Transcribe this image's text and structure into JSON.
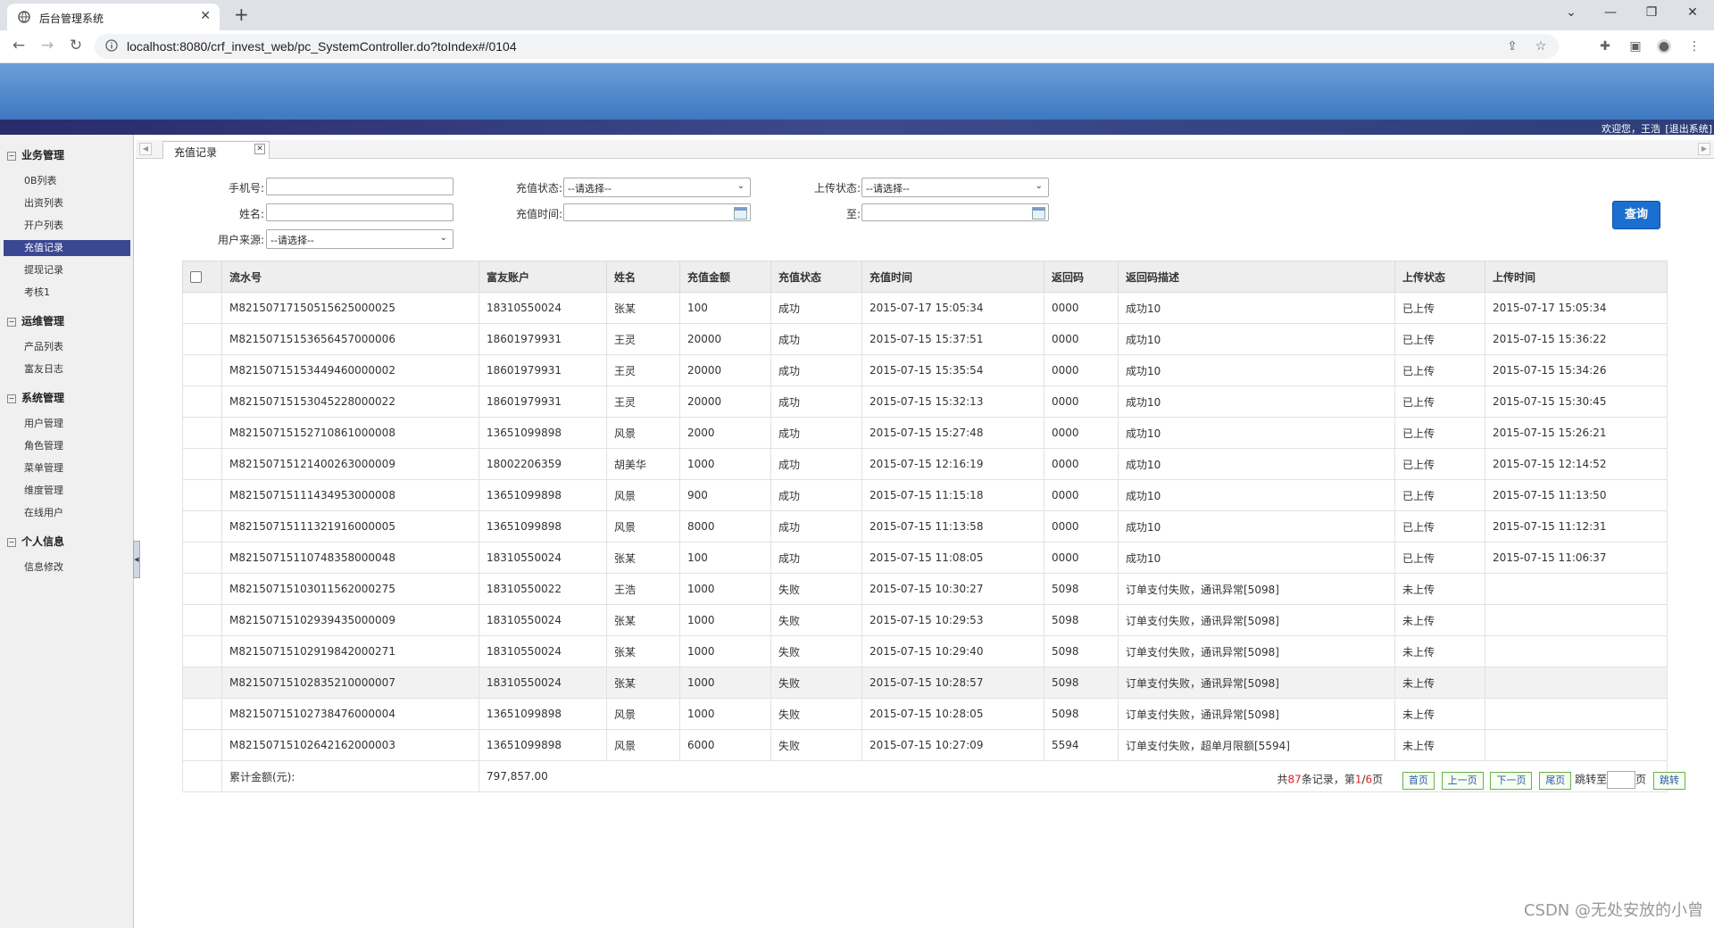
{
  "browser": {
    "tab_title": "后台管理系统",
    "tab_close": "✕",
    "new_tab": "+",
    "url": "localhost:8080/crf_invest_web/pc_SystemController.do?toIndex#/0104"
  },
  "header": {
    "welcome": "欢迎您，王浩",
    "logout": "[退出系统]"
  },
  "sidebar": {
    "groups": [
      {
        "title": "业务管理",
        "items": [
          "0B列表",
          "出资列表",
          "开户列表",
          "充值记录",
          "提现记录",
          "考核1"
        ]
      },
      {
        "title": "运维管理",
        "items": [
          "产品列表",
          "富友日志"
        ]
      },
      {
        "title": "系统管理",
        "items": [
          "用户管理",
          "角色管理",
          "菜单管理",
          "维度管理",
          "在线用户"
        ]
      },
      {
        "title": "个人信息",
        "items": [
          "信息修改"
        ]
      }
    ],
    "active_item": "充值记录"
  },
  "content_tab": {
    "label": "充值记录",
    "close": "✕"
  },
  "filters": {
    "phone_label": "手机号:",
    "phone_value": "",
    "name_label": "姓名:",
    "name_value": "",
    "source_label": "用户来源:",
    "source_value": "--请选择--",
    "recharge_status_label": "充值状态:",
    "recharge_status_value": "--请选择--",
    "recharge_time_label": "充值时间:",
    "recharge_time_value": "",
    "upload_status_label": "上传状态:",
    "upload_status_value": "--请选择--",
    "to_label": "至:",
    "to_value": "",
    "query_button": "查询"
  },
  "table": {
    "columns": [
      "流水号",
      "富友账户",
      "姓名",
      "充值金额",
      "充值状态",
      "充值时间",
      "返回码",
      "返回码描述",
      "上传状态",
      "上传时间"
    ],
    "rows": [
      [
        "M82150717150515625000025",
        "18310550024",
        "张某",
        "100",
        "成功",
        "2015-07-17 15:05:34",
        "0000",
        "成功10",
        "已上传",
        "2015-07-17 15:05:34"
      ],
      [
        "M82150715153656457000006",
        "18601979931",
        "王灵",
        "20000",
        "成功",
        "2015-07-15 15:37:51",
        "0000",
        "成功10",
        "已上传",
        "2015-07-15 15:36:22"
      ],
      [
        "M82150715153449460000002",
        "18601979931",
        "王灵",
        "20000",
        "成功",
        "2015-07-15 15:35:54",
        "0000",
        "成功10",
        "已上传",
        "2015-07-15 15:34:26"
      ],
      [
        "M82150715153045228000022",
        "18601979931",
        "王灵",
        "20000",
        "成功",
        "2015-07-15 15:32:13",
        "0000",
        "成功10",
        "已上传",
        "2015-07-15 15:30:45"
      ],
      [
        "M82150715152710861000008",
        "13651099898",
        "风景",
        "2000",
        "成功",
        "2015-07-15 15:27:48",
        "0000",
        "成功10",
        "已上传",
        "2015-07-15 15:26:21"
      ],
      [
        "M82150715121400263000009",
        "18002206359",
        "胡美华",
        "1000",
        "成功",
        "2015-07-15 12:16:19",
        "0000",
        "成功10",
        "已上传",
        "2015-07-15 12:14:52"
      ],
      [
        "M82150715111434953000008",
        "13651099898",
        "风景",
        "900",
        "成功",
        "2015-07-15 11:15:18",
        "0000",
        "成功10",
        "已上传",
        "2015-07-15 11:13:50"
      ],
      [
        "M82150715111321916000005",
        "13651099898",
        "风景",
        "8000",
        "成功",
        "2015-07-15 11:13:58",
        "0000",
        "成功10",
        "已上传",
        "2015-07-15 11:12:31"
      ],
      [
        "M82150715110748358000048",
        "18310550024",
        "张某",
        "100",
        "成功",
        "2015-07-15 11:08:05",
        "0000",
        "成功10",
        "已上传",
        "2015-07-15 11:06:37"
      ],
      [
        "M82150715103011562000275",
        "18310550022",
        "王浩",
        "1000",
        "失败",
        "2015-07-15 10:30:27",
        "5098",
        "订单支付失败，通讯异常[5098]",
        "未上传",
        ""
      ],
      [
        "M82150715102939435000009",
        "18310550024",
        "张某",
        "1000",
        "失败",
        "2015-07-15 10:29:53",
        "5098",
        "订单支付失败，通讯异常[5098]",
        "未上传",
        ""
      ],
      [
        "M82150715102919842000271",
        "18310550024",
        "张某",
        "1000",
        "失败",
        "2015-07-15 10:29:40",
        "5098",
        "订单支付失败，通讯异常[5098]",
        "未上传",
        ""
      ],
      [
        "M82150715102835210000007",
        "18310550024",
        "张某",
        "1000",
        "失败",
        "2015-07-15 10:28:57",
        "5098",
        "订单支付失败，通讯异常[5098]",
        "未上传",
        ""
      ],
      [
        "M82150715102738476000004",
        "13651099898",
        "风景",
        "1000",
        "失败",
        "2015-07-15 10:28:05",
        "5098",
        "订单支付失败，通讯异常[5098]",
        "未上传",
        ""
      ],
      [
        "M82150715102642162000003",
        "13651099898",
        "风景",
        "6000",
        "失败",
        "2015-07-15 10:27:09",
        "5594",
        "订单支付失败，超单月限额[5594]",
        "未上传",
        ""
      ]
    ],
    "highlighted_row": 12,
    "footer_label": "累计金额(元):",
    "footer_value": "797,857.00"
  },
  "pager": {
    "prefix": "共",
    "total": "87",
    "mid": "条记录，第",
    "current": "1",
    "slash": "/",
    "pages": "6",
    "suffix": "页",
    "first": "首页",
    "prev": "上一页",
    "next": "下一页",
    "last": "尾页",
    "jump_label": "跳转至",
    "page_unit": "页",
    "jump_button": "跳转"
  },
  "watermark": "CSDN @无处安放的小曾"
}
